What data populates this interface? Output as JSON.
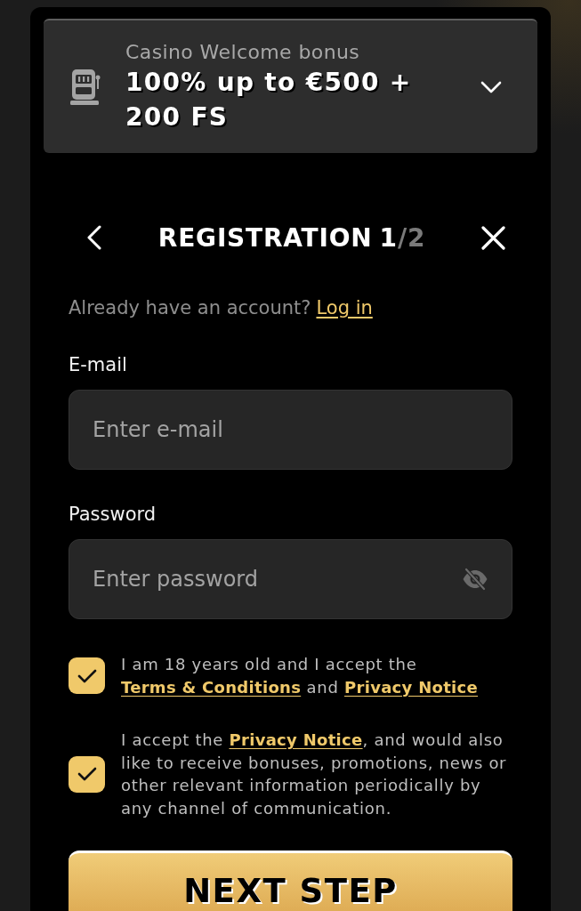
{
  "bonus": {
    "category": "Casino Welcome bonus",
    "offer": "100% up to €500 + 200 FS",
    "expanded": false
  },
  "header": {
    "title": "REGISTRATION",
    "step": "1",
    "total": "/2"
  },
  "login_prompt": {
    "text": "Already have an account?",
    "link": "Log in"
  },
  "fields": [
    {
      "kind": "email",
      "label": "E-mail",
      "placeholder": "Enter e-mail"
    },
    {
      "kind": "password",
      "label": "Password",
      "placeholder": "Enter password"
    }
  ],
  "consents": [
    {
      "checked": true,
      "parts": [
        {
          "kind": "text",
          "text": "I am 18 years old and I accept the "
        },
        {
          "kind": "link",
          "text": "Terms & Conditions"
        },
        {
          "kind": "text",
          "text": " and "
        },
        {
          "kind": "link",
          "text": "Privacy Notice"
        }
      ]
    },
    {
      "checked": true,
      "parts": [
        {
          "kind": "text",
          "text": "I accept the "
        },
        {
          "kind": "link",
          "text": "Privacy Notice"
        },
        {
          "kind": "text",
          "text": ", and would also like to receive bonuses, promotions, news or other relevant information periodically by any channel of communication."
        }
      ]
    }
  ],
  "submit": "NEXT STEP"
}
